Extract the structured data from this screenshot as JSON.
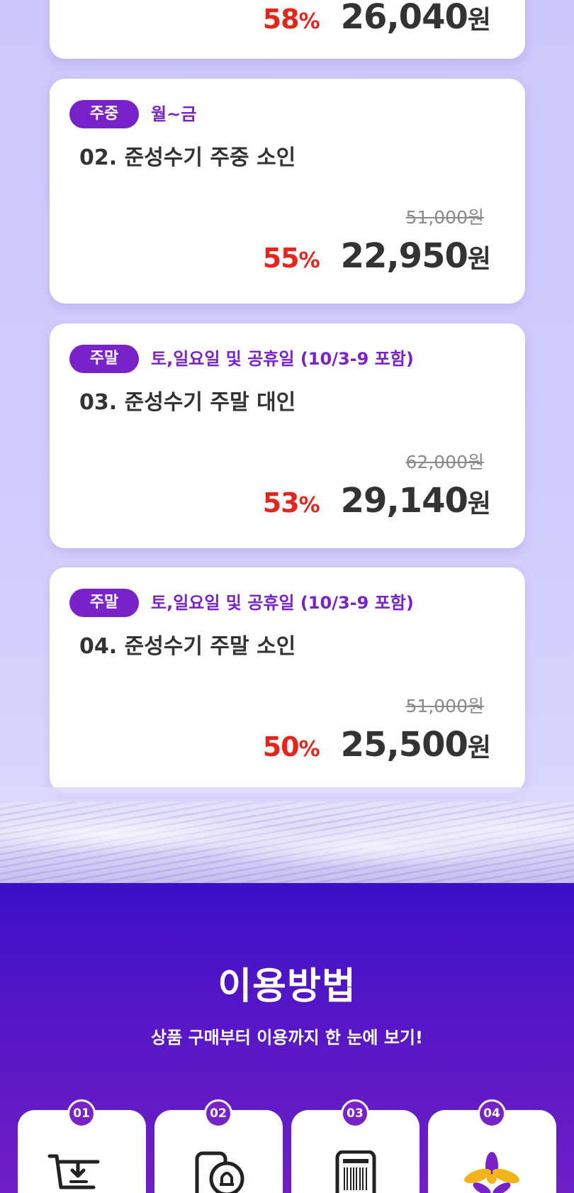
{
  "products": [
    {
      "badge": "",
      "days": "",
      "name": "",
      "original_price": "",
      "discount": "58",
      "discount_unit": "%",
      "price": "26,040",
      "currency": "원"
    },
    {
      "badge": "주중",
      "days": "월~금",
      "name": "02. 준성수기 주중 소인",
      "original_price": "51,000원",
      "discount": "55",
      "discount_unit": "%",
      "price": "22,950",
      "currency": "원"
    },
    {
      "badge": "주말",
      "days": "토,일요일 및 공휴일 (10/3-9 포함)",
      "name": "03. 준성수기 주말 대인",
      "original_price": "62,000원",
      "discount": "53",
      "discount_unit": "%",
      "price": "29,140",
      "currency": "원"
    },
    {
      "badge": "주말",
      "days": "토,일요일 및 공휴일 (10/3-9 포함)",
      "name": "04. 준성수기 주말 소인",
      "original_price": "51,000원",
      "discount": "50",
      "discount_unit": "%",
      "price": "25,500",
      "currency": "원"
    }
  ],
  "howto": {
    "title": "이용방법",
    "subtitle": "상품 구매부터 이용까지 한 눈에 보기!",
    "steps": [
      {
        "number": "01",
        "icon": "cart-download-icon"
      },
      {
        "number": "02",
        "icon": "phone-bell-icon"
      },
      {
        "number": "03",
        "icon": "mobile-barcode-icon"
      },
      {
        "number": "04",
        "icon": "flower-logo-icon"
      }
    ]
  },
  "colors": {
    "accent_purple": "#7a22c9",
    "discount_red": "#e6241a",
    "section_blue": "#3b10c8"
  }
}
